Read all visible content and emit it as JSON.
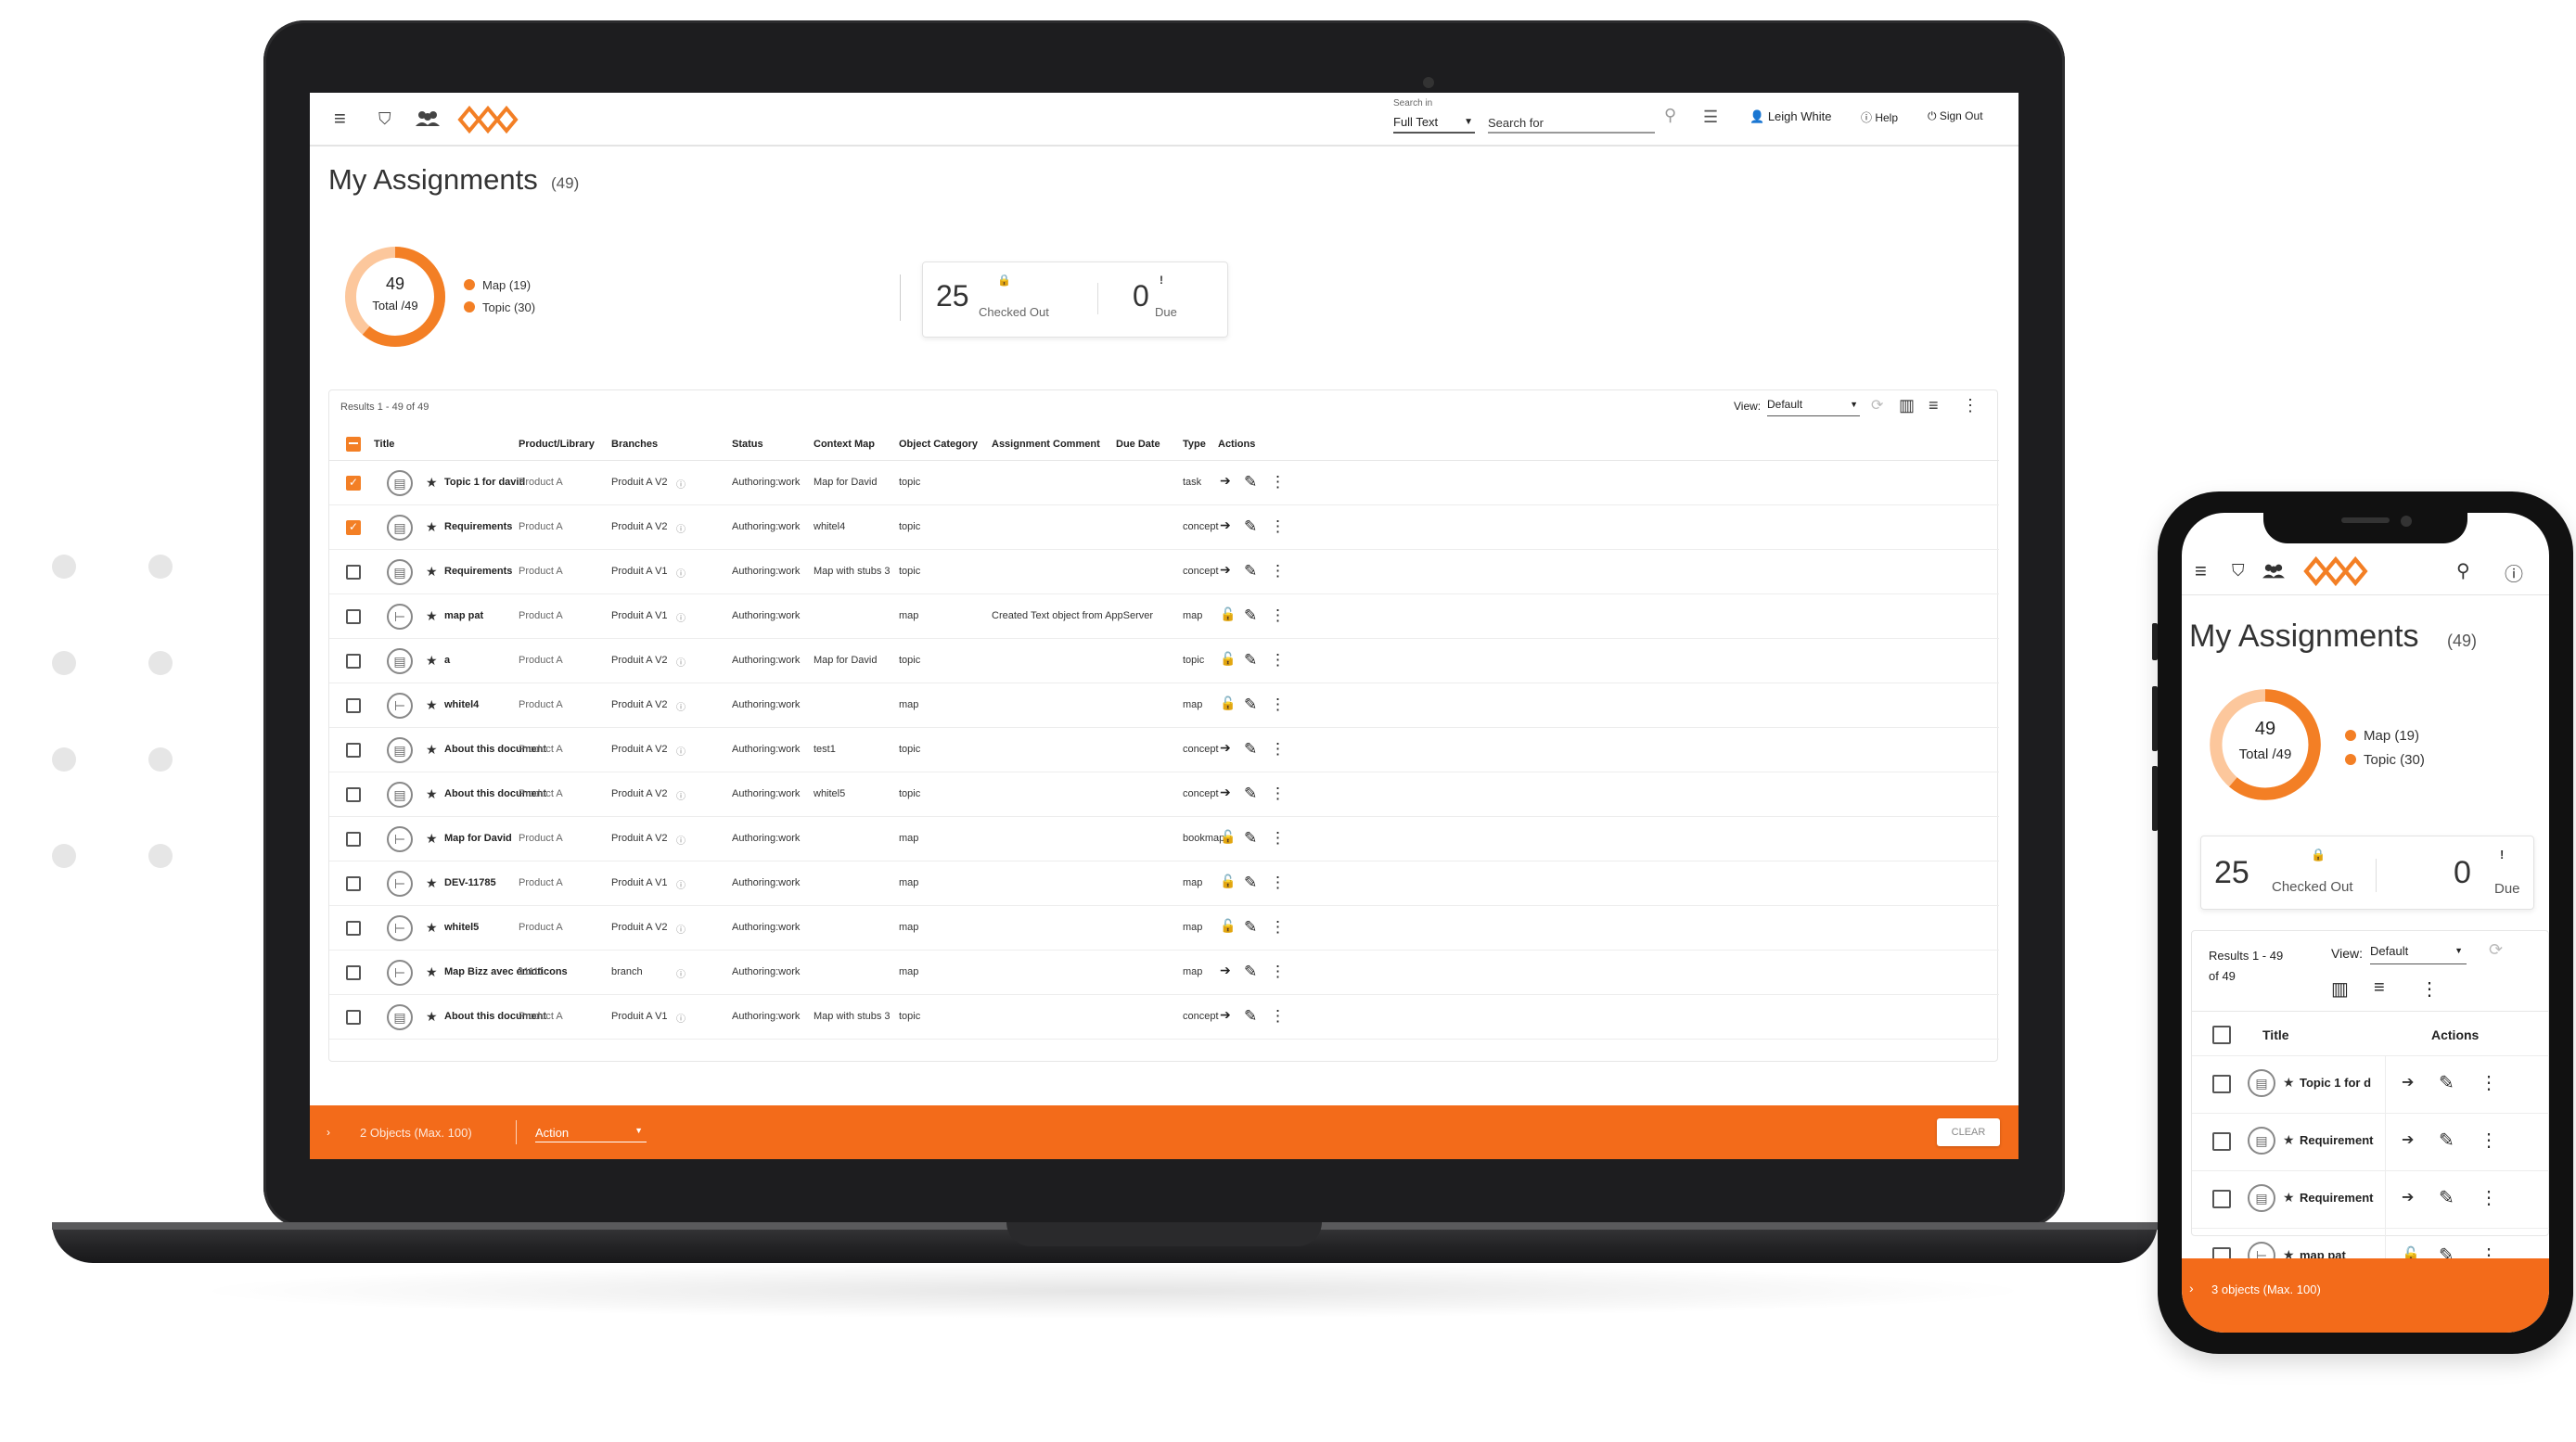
{
  "header": {
    "search_in_label": "Search in",
    "search_in_value": "Full Text",
    "search_placeholder": "Search for",
    "user": "Leigh White",
    "help": "Help",
    "sign_out": "Sign Out"
  },
  "page": {
    "title": "My Assignments",
    "count": "(49)"
  },
  "summary": {
    "total": "49",
    "total_label": "Total /49",
    "map_label": "Map (19)",
    "topic_label": "Topic (30)",
    "map_count": 19,
    "topic_count": 30,
    "checked_out_count": "25",
    "checked_out_label": "Checked Out",
    "due_count": "0",
    "due_label": "Due"
  },
  "table": {
    "results": "Results 1 - 49 of 49",
    "view_label": "View:",
    "view_value": "Default",
    "columns": [
      "Title",
      "Product/Library",
      "Branches",
      "Status",
      "Context Map",
      "Object Category",
      "Assignment Comment",
      "Due Date",
      "Type",
      "Actions"
    ],
    "rows": [
      {
        "title": "Topic 1 for david",
        "product": "Product A",
        "branch": "Produit A V2",
        "status": "Authoring:work",
        "context": "Map for David",
        "category": "topic",
        "comment": "",
        "type": "task",
        "kind": "topic",
        "checked": true,
        "first_action": "arrow"
      },
      {
        "title": "Requirements",
        "product": "Product A",
        "branch": "Produit A V2",
        "status": "Authoring:work",
        "context": "whitel4",
        "category": "topic",
        "comment": "",
        "type": "concept",
        "kind": "topic",
        "checked": true,
        "first_action": "arrow"
      },
      {
        "title": "Requirements",
        "product": "Product A",
        "branch": "Produit A V1",
        "status": "Authoring:work",
        "context": "Map with stubs 3",
        "category": "topic",
        "comment": "",
        "type": "concept",
        "kind": "topic",
        "checked": false,
        "first_action": "arrow"
      },
      {
        "title": "map pat",
        "product": "Product A",
        "branch": "Produit A V1",
        "status": "Authoring:work",
        "context": "",
        "category": "map",
        "comment": "Created Text object from AppServer",
        "type": "map",
        "kind": "map",
        "checked": false,
        "first_action": "lock"
      },
      {
        "title": "a",
        "product": "Product A",
        "branch": "Produit A V2",
        "status": "Authoring:work",
        "context": "Map for David",
        "category": "topic",
        "comment": "",
        "type": "topic",
        "kind": "topic",
        "checked": false,
        "first_action": "lock"
      },
      {
        "title": "whitel4",
        "product": "Product A",
        "branch": "Produit A V2",
        "status": "Authoring:work",
        "context": "",
        "category": "map",
        "comment": "",
        "type": "map",
        "kind": "map",
        "checked": false,
        "first_action": "lock"
      },
      {
        "title": "About this document",
        "product": "Product A",
        "branch": "Produit A V2",
        "status": "Authoring:work",
        "context": "test1",
        "category": "topic",
        "comment": "",
        "type": "concept",
        "kind": "topic",
        "checked": false,
        "first_action": "arrow"
      },
      {
        "title": "About this document",
        "product": "Product A",
        "branch": "Produit A V2",
        "status": "Authoring:work",
        "context": "whitel5",
        "category": "topic",
        "comment": "",
        "type": "concept",
        "kind": "topic",
        "checked": false,
        "first_action": "arrow"
      },
      {
        "title": "Map for David",
        "product": "Product A",
        "branch": "Produit A V2",
        "status": "Authoring:work",
        "context": "",
        "category": "map",
        "comment": "",
        "type": "bookmap",
        "kind": "map",
        "checked": false,
        "first_action": "lock"
      },
      {
        "title": "DEV-11785",
        "product": "Product A",
        "branch": "Produit A V1",
        "status": "Authoring:work",
        "context": "",
        "category": "map",
        "comment": "",
        "type": "map",
        "kind": "map",
        "checked": false,
        "first_action": "lock"
      },
      {
        "title": "whitel5",
        "product": "Product A",
        "branch": "Produit A V2",
        "status": "Authoring:work",
        "context": "",
        "category": "map",
        "comment": "",
        "type": "map",
        "kind": "map",
        "checked": false,
        "first_action": "lock"
      },
      {
        "title": "Map Bizz avec émoticons",
        "product": "11111",
        "branch": "branch",
        "status": "Authoring:work",
        "context": "",
        "category": "map",
        "comment": "",
        "type": "map",
        "kind": "map",
        "checked": false,
        "first_action": "arrow"
      },
      {
        "title": "About this document",
        "product": "Product A",
        "branch": "Produit A V1",
        "status": "Authoring:work",
        "context": "Map with stubs 3",
        "category": "topic",
        "comment": "",
        "type": "concept",
        "kind": "topic",
        "checked": false,
        "first_action": "arrow"
      }
    ]
  },
  "bottom_bar": {
    "selection": "2 Objects (Max. 100)",
    "action_label": "Action",
    "clear": "CLEAR"
  },
  "phone": {
    "title": "My Assignments",
    "count": "(49)",
    "total": "49",
    "total_label": "Total /49",
    "map_label": "Map (19)",
    "topic_label": "Topic (30)",
    "checked_out_count": "25",
    "checked_out_label": "Checked Out",
    "due_count": "0",
    "due_label": "Due",
    "results_line1": "Results 1 - 49",
    "results_line2": "of 49",
    "view_label": "View:",
    "view_value": "Default",
    "col_title": "Title",
    "col_actions": "Actions",
    "rows": [
      {
        "title": "Topic 1 for d"
      },
      {
        "title": "Requirement"
      },
      {
        "title": "Requirement"
      },
      {
        "title": "map pat"
      }
    ],
    "selection": "3 objects (Max. 100)"
  },
  "colors": {
    "accent": "#f37f25",
    "bar": "#f36b1a"
  }
}
